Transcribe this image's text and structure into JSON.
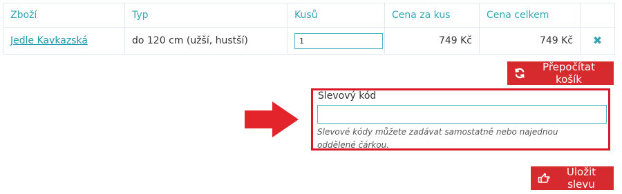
{
  "table": {
    "headers": [
      "Zboží",
      "Typ",
      "Kusů",
      "Cena za kus",
      "Cena celkem"
    ],
    "rows": [
      {
        "product": "Jedle Kavkazská",
        "type": "do 120 cm (užší, hustší)",
        "quantity": "1",
        "unit_price": "749 Kč",
        "total_price": "749 Kč",
        "remove_icon": "close-icon"
      }
    ]
  },
  "buttons": {
    "recalculate": {
      "label": "Přepočítat košík",
      "icon": "refresh-icon"
    },
    "save_discount": {
      "label": "Uložit slevu",
      "icon": "hand-point-icon"
    }
  },
  "discount": {
    "label": "Slevový kód",
    "value": "",
    "hint": "Slevové kódy můžete zadávat samostatně nebo najednou oddělené čárkou."
  },
  "colors": {
    "accent": "#31a7b6",
    "button": "#d62a2f",
    "highlight": "#d9192a"
  }
}
